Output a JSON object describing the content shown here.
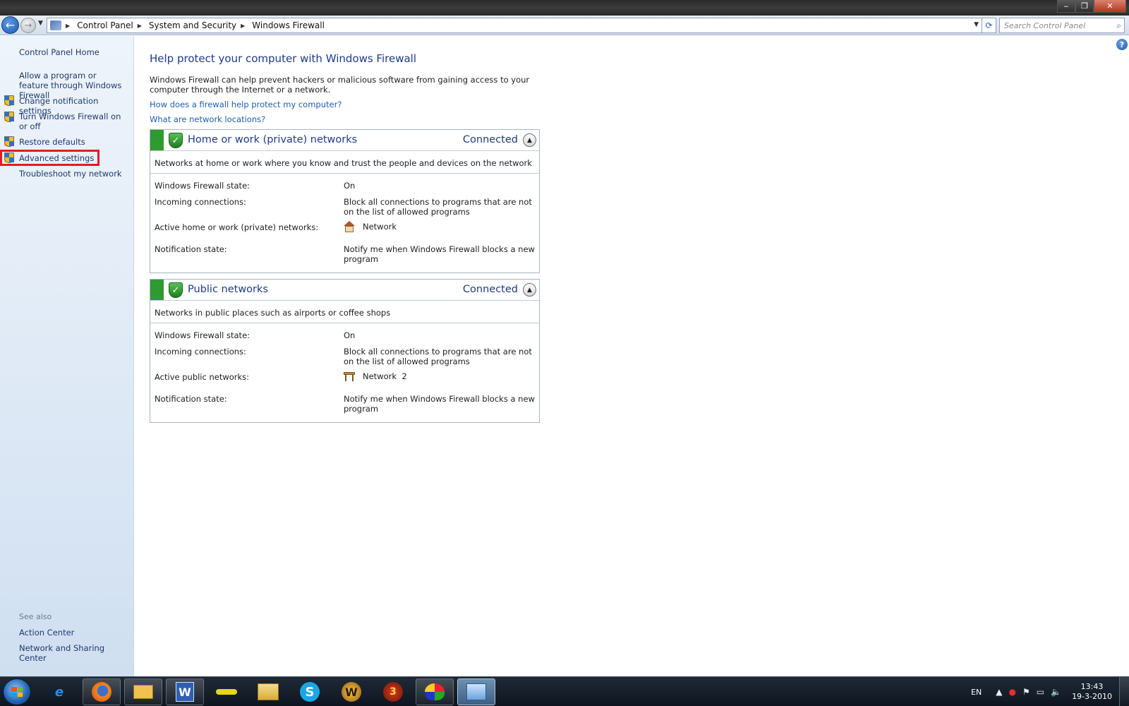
{
  "window": {
    "minimize": "‒",
    "maximize": "❐",
    "close": "✕"
  },
  "address": {
    "crumbs": [
      "Control Panel",
      "System and Security",
      "Windows Firewall"
    ],
    "search_placeholder": "Search Control Panel"
  },
  "sidebar": {
    "home": "Control Panel Home",
    "items": [
      {
        "label": "Allow a program or feature through Windows Firewall",
        "icon": "none"
      },
      {
        "label": "Change notification settings",
        "icon": "shield-icon"
      },
      {
        "label": "Turn Windows Firewall on or off",
        "icon": "shield-icon"
      },
      {
        "label": "Restore defaults",
        "icon": "shield-icon"
      },
      {
        "label": "Advanced settings",
        "icon": "shield-icon",
        "highlighted": true
      },
      {
        "label": "Troubleshoot my network",
        "icon": "none"
      }
    ],
    "see_also_heading": "See also",
    "see_also": [
      "Action Center",
      "Network and Sharing Center"
    ]
  },
  "main": {
    "title": "Help protect your computer with Windows Firewall",
    "intro": "Windows Firewall can help prevent hackers or malicious software from gaining access to your computer through the Internet or a network.",
    "link1": "How does a firewall help protect my computer?",
    "link2": "What are network locations?",
    "panels": [
      {
        "title": "Home or work (private) networks",
        "status": "Connected",
        "description": "Networks at home or work where you know and trust the people and devices on the network",
        "state_label": "Windows Firewall state:",
        "state_value": "On",
        "incoming_label": "Incoming connections:",
        "incoming_value": "Block all connections to programs that are not on the list of allowed programs",
        "active_label": "Active home or work (private) networks:",
        "active_value": "Network",
        "active_icon": "house-icon",
        "notify_label": "Notification state:",
        "notify_value": "Notify me when Windows Firewall blocks a new program"
      },
      {
        "title": "Public networks",
        "status": "Connected",
        "description": "Networks in public places such as airports or coffee shops",
        "state_label": "Windows Firewall state:",
        "state_value": "On",
        "incoming_label": "Incoming connections:",
        "incoming_value": "Block all connections to programs that are not on the list of allowed programs",
        "active_label": "Active public networks:",
        "active_value": "Network  2",
        "active_icon": "bench-icon",
        "notify_label": "Notification state:",
        "notify_value": "Notify me when Windows Firewall blocks a new program"
      }
    ]
  },
  "taskbar": {
    "ie_glyph": "e",
    "word_glyph": "W",
    "skype_glyph": "S",
    "wow_glyph": "W",
    "game_glyph": "3",
    "lang": "EN",
    "time": "13:43",
    "date": "19-3-2010"
  },
  "colors": {
    "accent_link": "#1d5fb4",
    "title_blue": "#1e3a8a",
    "firewall_green": "#2f9a2f",
    "highlight_red": "#e41b23"
  }
}
